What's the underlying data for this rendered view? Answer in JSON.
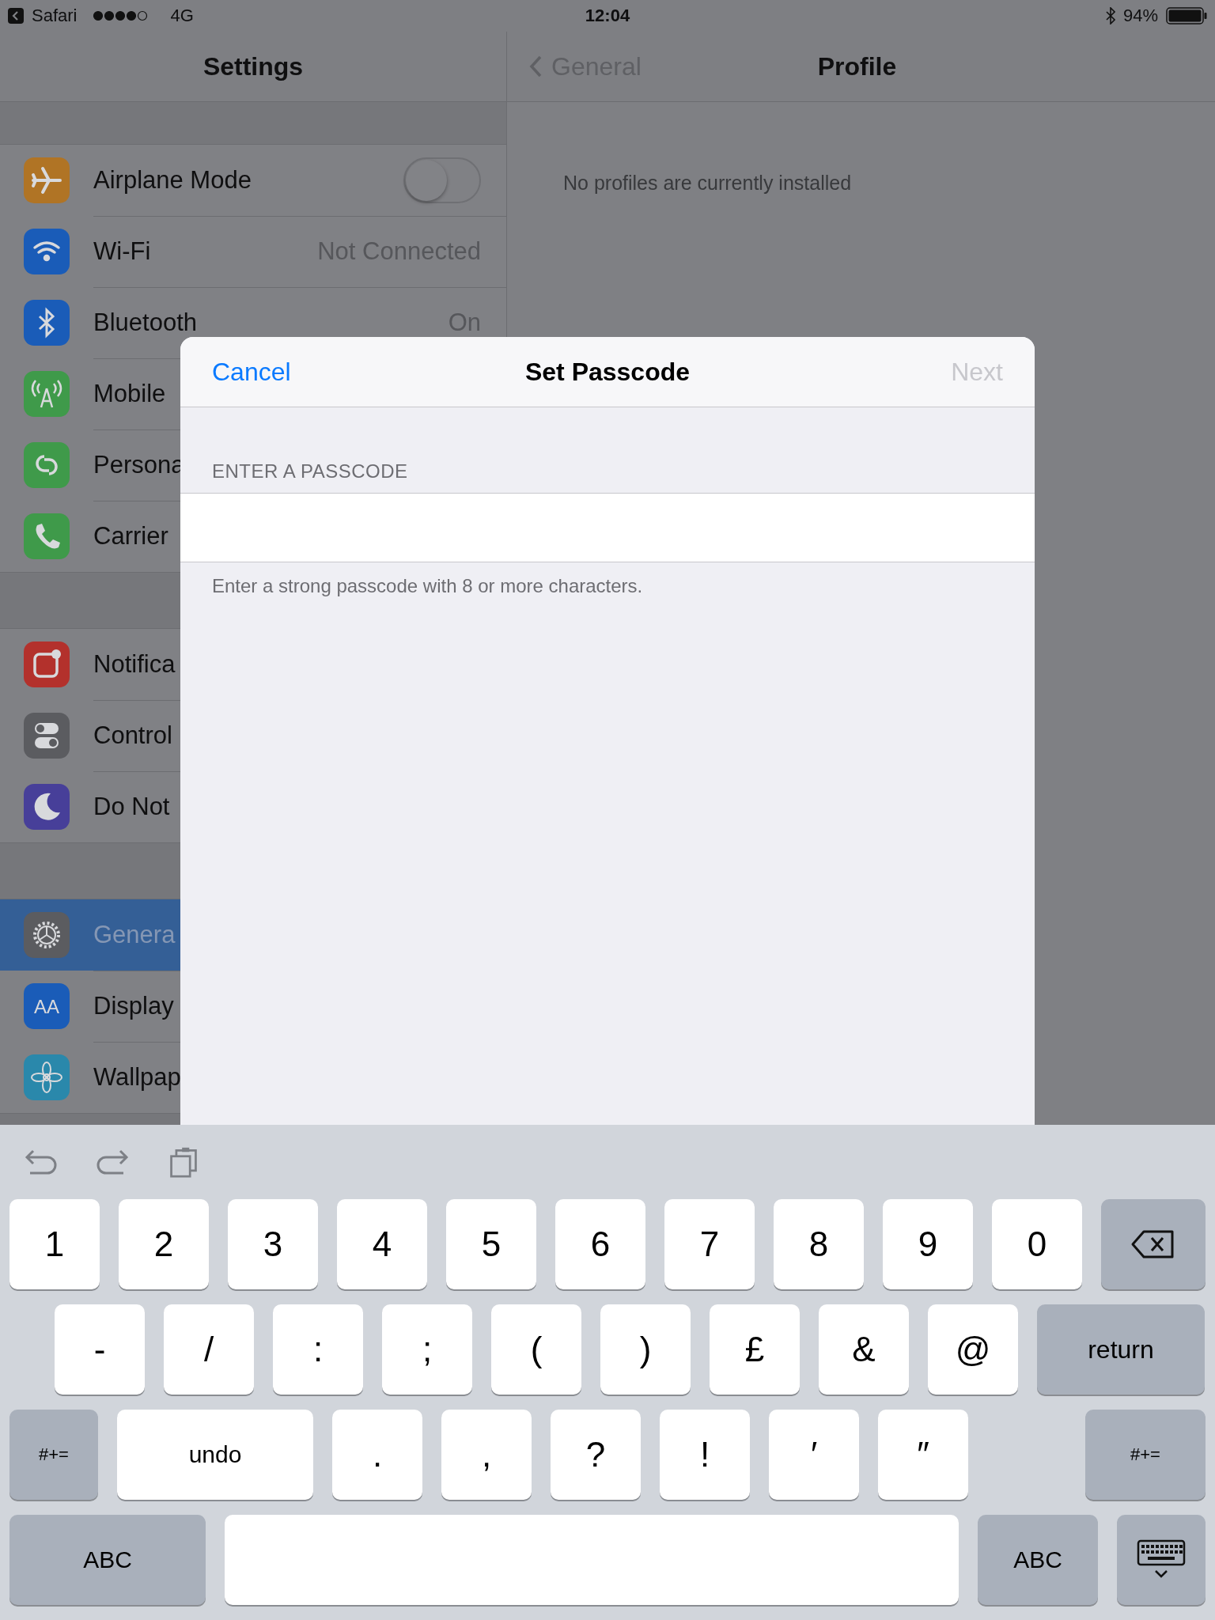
{
  "status_bar": {
    "back_app": "Safari",
    "network": "4G",
    "time": "12:04",
    "battery": "94%"
  },
  "sidebar": {
    "title": "Settings",
    "groups": [
      {
        "items": [
          {
            "label": "Airplane Mode",
            "kind": "toggle",
            "on": false,
            "selected": false,
            "color": "#b07425"
          },
          {
            "label": "Wi-Fi",
            "kind": "value",
            "value": "Not Connected",
            "selected": false,
            "color": "#1a5cb8"
          },
          {
            "label": "Bluetooth",
            "kind": "value",
            "value": "On",
            "selected": false,
            "color": "#1a5cb8"
          },
          {
            "label": "Mobile",
            "kind": "link",
            "selected": false,
            "color": "#3f9a4a"
          },
          {
            "label": "Persona",
            "kind": "link",
            "selected": false,
            "color": "#3f9a4a"
          },
          {
            "label": "Carrier",
            "kind": "link",
            "selected": false,
            "color": "#3f9a4a"
          }
        ]
      },
      {
        "items": [
          {
            "label": "Notifica",
            "kind": "link",
            "selected": false,
            "color": "#b3312c"
          },
          {
            "label": "Control",
            "kind": "link",
            "selected": false,
            "color": "#5b5c60"
          },
          {
            "label": "Do Not",
            "kind": "link",
            "selected": false,
            "color": "#473f99"
          }
        ]
      },
      {
        "items": [
          {
            "label": "Genera",
            "kind": "link",
            "selected": true,
            "color": "#5b5c60"
          },
          {
            "label": "Display",
            "kind": "link",
            "selected": false,
            "color": "#1a5cb8",
            "icon_text": "AA"
          },
          {
            "label": "Wallpap",
            "kind": "link",
            "selected": false,
            "color": "#2a88ab"
          }
        ]
      }
    ]
  },
  "detail": {
    "back": "General",
    "title": "Profile",
    "message": "No profiles are currently installed"
  },
  "modal": {
    "cancel": "Cancel",
    "title": "Set Passcode",
    "next": {
      "label": "Next",
      "disabled": true
    },
    "section": "ENTER A PASSCODE",
    "hint": "Enter a strong passcode with 8 or more characters."
  },
  "keyboard": {
    "rows": [
      [
        {
          "label": "1",
          "kind": "char"
        },
        {
          "label": "2",
          "kind": "char"
        },
        {
          "label": "3",
          "kind": "char"
        },
        {
          "label": "4",
          "kind": "char"
        },
        {
          "label": "5",
          "kind": "char"
        },
        {
          "label": "6",
          "kind": "char"
        },
        {
          "label": "7",
          "kind": "char"
        },
        {
          "label": "8",
          "kind": "char"
        },
        {
          "label": "9",
          "kind": "char"
        },
        {
          "label": "0",
          "kind": "char"
        },
        {
          "kind": "backspace"
        }
      ],
      [
        {
          "label": "-",
          "kind": "char"
        },
        {
          "label": "/",
          "kind": "char"
        },
        {
          "label": ":",
          "kind": "char"
        },
        {
          "label": ";",
          "kind": "char"
        },
        {
          "label": "(",
          "kind": "char"
        },
        {
          "label": ")",
          "kind": "char"
        },
        {
          "label": "£",
          "kind": "char"
        },
        {
          "label": "&",
          "kind": "char"
        },
        {
          "label": "@",
          "kind": "char"
        },
        {
          "label": "return",
          "kind": "return"
        }
      ],
      [
        {
          "label": "#+=",
          "kind": "shift"
        },
        {
          "label": "undo",
          "kind": "undo"
        },
        {
          "label": ".",
          "kind": "char"
        },
        {
          "label": ",",
          "kind": "char"
        },
        {
          "label": "?",
          "kind": "char"
        },
        {
          "label": "!",
          "kind": "char"
        },
        {
          "label": "′",
          "kind": "char"
        },
        {
          "label": "″",
          "kind": "char"
        },
        {
          "label": "#+=",
          "kind": "shift-right"
        }
      ],
      [
        {
          "label": "ABC",
          "kind": "abc"
        },
        {
          "kind": "space"
        },
        {
          "label": "ABC",
          "kind": "abc-right"
        },
        {
          "kind": "dismiss"
        }
      ]
    ]
  }
}
